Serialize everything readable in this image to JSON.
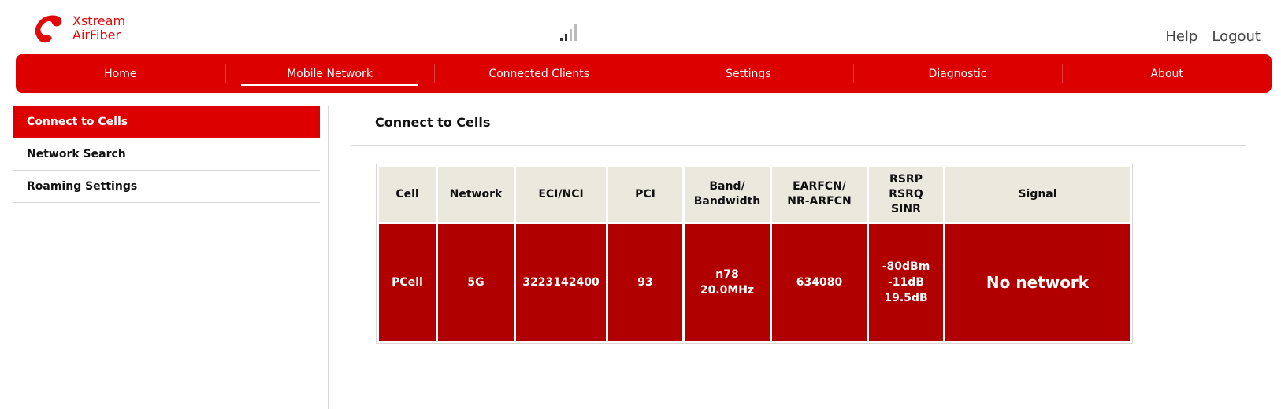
{
  "brand": {
    "line1": "Xstream",
    "line2": "AirFiber",
    "color": "#e10a0a"
  },
  "header": {
    "help_label": "Help",
    "logout_label": "Logout"
  },
  "nav": {
    "items": [
      {
        "label": "Home"
      },
      {
        "label": "Mobile Network"
      },
      {
        "label": "Connected Clients"
      },
      {
        "label": "Settings"
      },
      {
        "label": "Diagnostic"
      },
      {
        "label": "About"
      }
    ],
    "active": "Mobile Network"
  },
  "sidebar": {
    "items": [
      {
        "label": "Connect to Cells"
      },
      {
        "label": "Network Search"
      },
      {
        "label": "Roaming Settings"
      }
    ],
    "active": "Connect to Cells"
  },
  "content": {
    "title": "Connect to Cells",
    "table": {
      "headers": {
        "cell": "Cell",
        "network": "Network",
        "eci": "ECI/NCI",
        "pci": "PCI",
        "band_l1": "Band/",
        "band_l2": "Bandwidth",
        "earfcn_l1": "EARFCN/",
        "earfcn_l2": "NR-ARFCN",
        "rsrp": "RSRP",
        "rsrq": "RSRQ",
        "sinr": "SINR",
        "signal": "Signal"
      },
      "rows": [
        {
          "cell": "PCell",
          "network": "5G",
          "eci": "3223142400",
          "pci": "93",
          "band": "n78",
          "bandwidth": "20.0MHz",
          "earfcn": "634080",
          "rsrp": "-80dBm",
          "rsrq": "-11dB",
          "sinr": "19.5dB",
          "signal": "No network"
        }
      ]
    }
  },
  "colors": {
    "accent": "#dc0000",
    "cell_bg": "#b10000",
    "header_bg": "#ebe9dd"
  }
}
